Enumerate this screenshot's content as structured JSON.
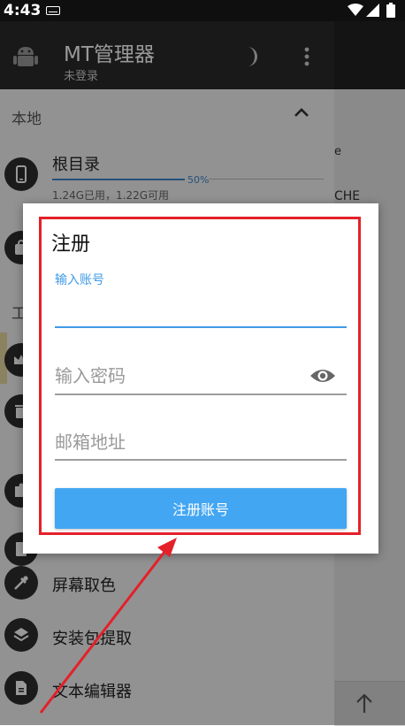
{
  "status_bar": {
    "time": "4:43"
  },
  "app": {
    "title": "MT管理器",
    "subtitle": "未登录",
    "colors": {
      "accent": "#43a6f2",
      "annotation": "#e4202a"
    }
  },
  "drawer": {
    "local_header": "本地",
    "tools_header": "工",
    "root_item": {
      "label": "根目录",
      "usage_percent": "50%",
      "usage_info": "1.24G已用，1.22G可用"
    },
    "items": [
      {
        "label": "屏幕取色",
        "icon": "eyedropper-icon"
      },
      {
        "label": "安装包提取",
        "icon": "layers-icon"
      },
      {
        "label": "文本编辑器",
        "icon": "document-icon"
      }
    ]
  },
  "background": {
    "fragment1": "e",
    "fragment2": "CHE"
  },
  "dialog": {
    "title": "注册",
    "account_label": "输入账号",
    "account_value": "",
    "password_placeholder": "输入密码",
    "email_placeholder": "邮箱地址",
    "register_button": "注册账号"
  }
}
